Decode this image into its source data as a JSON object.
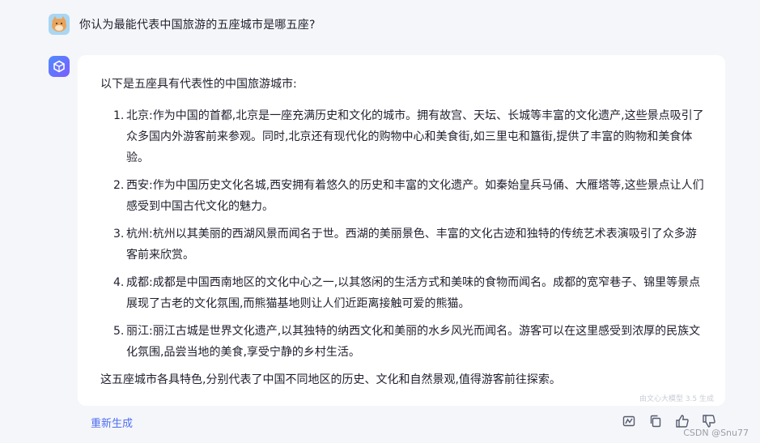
{
  "user": {
    "question": "你认为最能代表中国旅游的五座城市是哪五座?"
  },
  "answer": {
    "intro": "以下是五座具有代表性的中国旅游城市:",
    "items": [
      {
        "num": "1.",
        "text": "北京:作为中国的首都,北京是一座充满历史和文化的城市。拥有故宫、天坛、长城等丰富的文化遗产,这些景点吸引了众多国内外游客前来参观。同时,北京还有现代化的购物中心和美食街,如三里屯和簋街,提供了丰富的购物和美食体验。"
      },
      {
        "num": "2.",
        "text": "西安:作为中国历史文化名城,西安拥有着悠久的历史和丰富的文化遗产。如秦始皇兵马俑、大雁塔等,这些景点让人们感受到中国古代文化的魅力。"
      },
      {
        "num": "3.",
        "text": "杭州:杭州以其美丽的西湖风景而闻名于世。西湖的美丽景色、丰富的文化古迹和独特的传统艺术表演吸引了众多游客前来欣赏。"
      },
      {
        "num": "4.",
        "text": "成都:成都是中国西南地区的文化中心之一,以其悠闲的生活方式和美味的食物而闻名。成都的宽窄巷子、锦里等景点展现了古老的文化氛围,而熊猫基地则让人们近距离接触可爱的熊猫。"
      },
      {
        "num": "5.",
        "text": "丽江:丽江古城是世界文化遗产,以其独特的纳西文化和美丽的水乡风光而闻名。游客可以在这里感受到浓厚的民族文化氛围,品尝当地的美食,享受宁静的乡村生活。"
      }
    ],
    "outro": "这五座城市各具特色,分别代表了中国不同地区的历史、文化和自然景观,值得游客前往探索。",
    "model_note": "由文心大模型 3.5 生成"
  },
  "footer": {
    "regenerate_label": "重新生成",
    "watermark": "CSDN @Snu77"
  },
  "icons": {
    "user_avatar": "cat-avatar-icon",
    "bot_avatar": "ernie-bot-icon",
    "actions": [
      "chart-icon",
      "copy-icon",
      "thumbs-up-icon",
      "thumbs-down-icon"
    ]
  },
  "colors": {
    "accent": "#4e6ef2",
    "background": "#f5f6f9",
    "card": "#ffffff"
  }
}
